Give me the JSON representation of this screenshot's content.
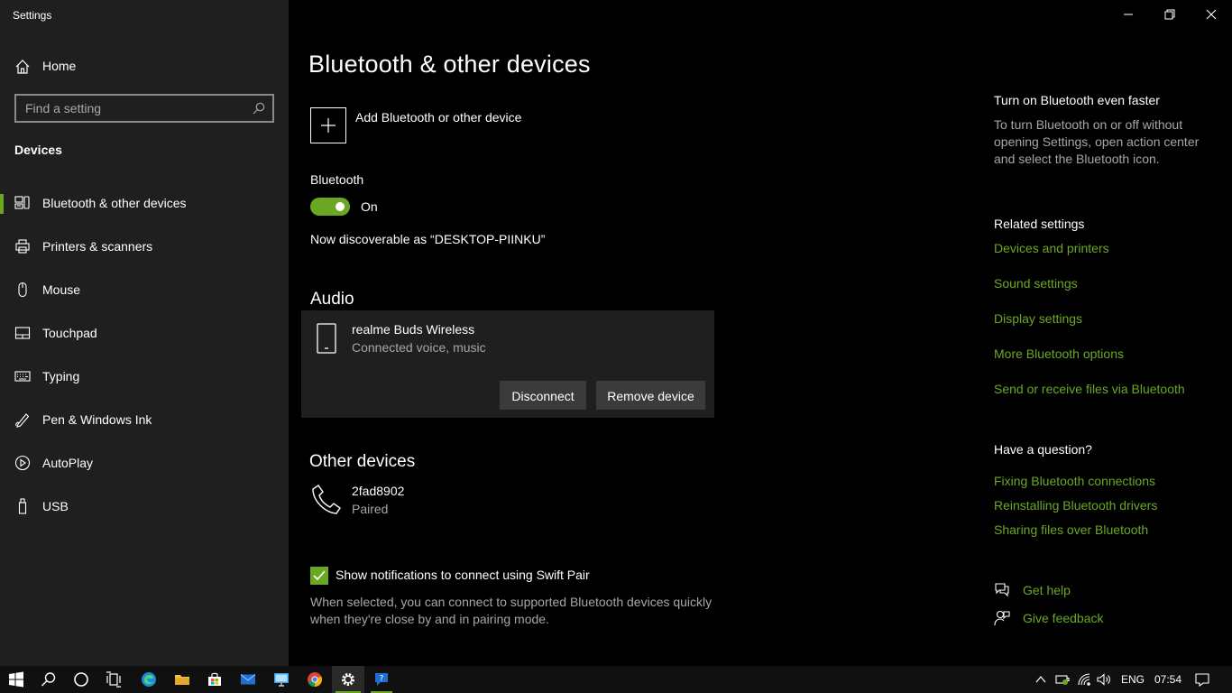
{
  "window": {
    "title": "Settings",
    "controls": [
      "minimize-icon",
      "restore-icon",
      "close-icon"
    ]
  },
  "sidebar": {
    "home_label": "Home",
    "search": {
      "placeholder": "Find a setting"
    },
    "section_title": "Devices",
    "items": [
      {
        "label": "Bluetooth & other devices",
        "icon": "bluetooth-devices-icon",
        "selected": true
      },
      {
        "label": "Printers & scanners",
        "icon": "printer-icon"
      },
      {
        "label": "Mouse",
        "icon": "mouse-icon"
      },
      {
        "label": "Touchpad",
        "icon": "touchpad-icon"
      },
      {
        "label": "Typing",
        "icon": "keyboard-icon"
      },
      {
        "label": "Pen & Windows Ink",
        "icon": "pen-icon"
      },
      {
        "label": "AutoPlay",
        "icon": "autoplay-icon"
      },
      {
        "label": "USB",
        "icon": "usb-icon"
      }
    ]
  },
  "main": {
    "title": "Bluetooth & other devices",
    "add_device_label": "Add Bluetooth or other device",
    "bluetooth": {
      "label": "Bluetooth",
      "state": "On",
      "enabled": true
    },
    "discoverable_text": "Now discoverable as “DESKTOP-PIINKU”",
    "audio": {
      "heading": "Audio",
      "device": {
        "name": "realme Buds Wireless",
        "status": "Connected voice, music",
        "icon": "phone-device-icon"
      },
      "disconnect_label": "Disconnect",
      "remove_label": "Remove device"
    },
    "other": {
      "heading": "Other devices",
      "device": {
        "name": "2fad8902",
        "status": "Paired",
        "icon": "telephone-icon"
      }
    },
    "swift_pair": {
      "checked": true,
      "label": "Show notifications to connect using Swift Pair",
      "description": "When selected, you can connect to supported Bluetooth devices quickly when they're close by and in pairing mode."
    }
  },
  "right": {
    "tip": {
      "heading": "Turn on Bluetooth even faster",
      "body": "To turn Bluetooth on or off without opening Settings, open action center and select the Bluetooth icon."
    },
    "related": {
      "heading": "Related settings",
      "links": [
        "Devices and printers",
        "Sound settings",
        "Display settings",
        "More Bluetooth options",
        "Send or receive files via Bluetooth"
      ]
    },
    "question": {
      "heading": "Have a question?",
      "links": [
        "Fixing Bluetooth connections",
        "Reinstalling Bluetooth drivers",
        "Sharing files over Bluetooth"
      ]
    },
    "help": {
      "get_help": "Get help",
      "feedback": "Give feedback"
    }
  },
  "taskbar": {
    "apps": [
      "start-icon",
      "search-icon",
      "cortana-icon",
      "task-view-icon",
      "edge-icon",
      "file-explorer-icon",
      "store-icon",
      "mail-icon",
      "remote-desktop-icon",
      "chrome-icon",
      "settings-icon",
      "help-app-icon"
    ],
    "language": "ENG",
    "time": "07:54"
  },
  "colors": {
    "accent": "#6aa824",
    "sidebar_bg": "#1f1f1f",
    "main_bg": "#000000",
    "secondary_text": "#a6a6a6"
  }
}
